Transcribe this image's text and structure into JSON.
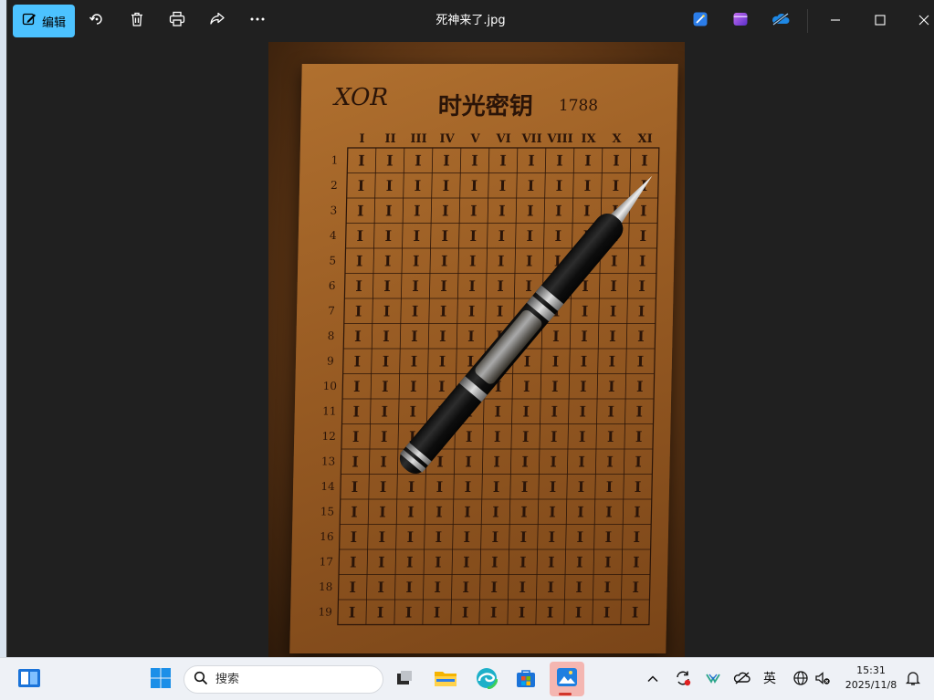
{
  "titlebar": {
    "edit_label": "编辑",
    "file_title": "死神来了.jpg",
    "icons": [
      "rotate-icon",
      "delete-icon",
      "print-icon",
      "share-icon",
      "more-icon",
      "designer-icon",
      "clipchamp-icon",
      "onedrive-icon",
      "minimize-icon",
      "maximize-icon",
      "close-icon"
    ]
  },
  "image": {
    "handwriting": "XOR",
    "sheet_title": "时光密钥",
    "sheet_year": "1788",
    "columns": [
      "I",
      "II",
      "III",
      "IV",
      "V",
      "VI",
      "VII",
      "VIII",
      "IX",
      "X",
      "XI"
    ],
    "rows": [
      "1",
      "2",
      "3",
      "4",
      "5",
      "6",
      "7",
      "8",
      "9",
      "10",
      "11",
      "12",
      "13",
      "14",
      "15",
      "16",
      "17",
      "18",
      "19"
    ],
    "cell_mark": "I"
  },
  "taskbar": {
    "search_placeholder": "搜索",
    "ime_label": "英",
    "time": "15:31",
    "date": "2025/11/8",
    "accent_active": "#d1352b"
  }
}
